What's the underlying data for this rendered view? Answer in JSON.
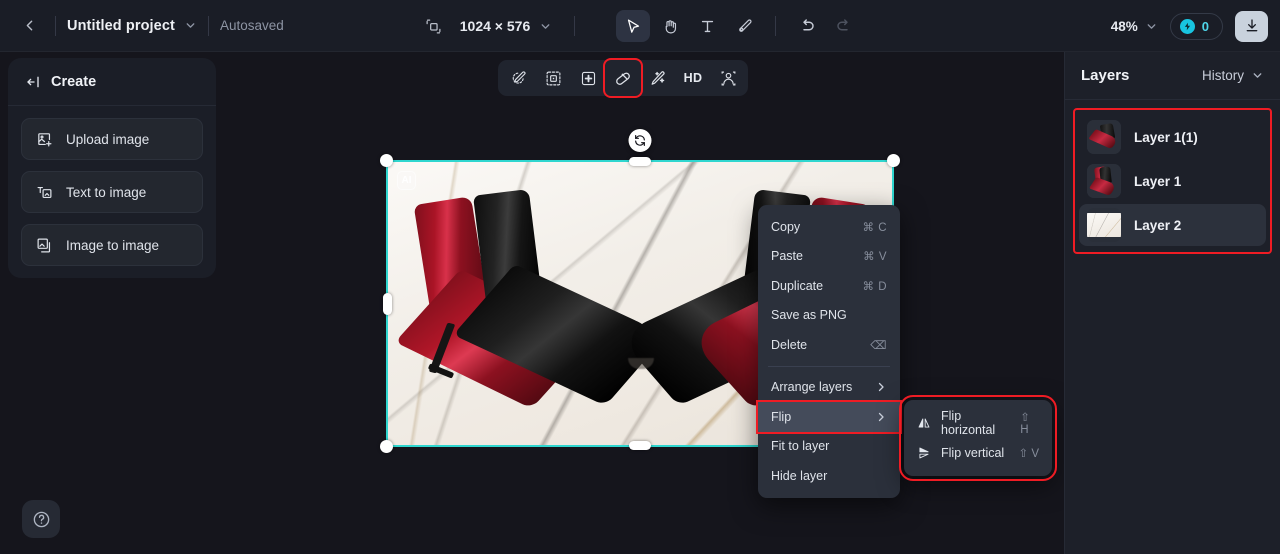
{
  "topbar": {
    "back_icon": "chevron-left-icon",
    "project_name": "Untitled project",
    "project_caret": "chevron-down-icon",
    "autosave_status": "Autosaved",
    "resize_icon": "resize-canvas-icon",
    "canvas_size": "1024 × 576",
    "size_caret": "chevron-down-icon",
    "tools": [
      {
        "name": "select-tool",
        "icon": "cursor-icon",
        "active": true
      },
      {
        "name": "hand-tool",
        "icon": "hand-icon",
        "active": false
      },
      {
        "name": "text-tool",
        "icon": "text-t-icon",
        "active": false
      },
      {
        "name": "brush-tool",
        "icon": "brush-icon",
        "active": false
      },
      {
        "name": "undo-tool",
        "icon": "undo-arrow-icon",
        "active": false
      },
      {
        "name": "redo-tool",
        "icon": "redo-arrow-icon",
        "active": false
      }
    ],
    "zoom_level": "48%",
    "zoom_caret": "chevron-down-icon",
    "credits_icon": "coin-icon",
    "credits_count": "0",
    "download_icon": "download-icon"
  },
  "create_panel": {
    "collapse_icon": "collapse-left-icon",
    "title": "Create",
    "items": [
      {
        "label": "Upload image",
        "icon": "image-upload-icon"
      },
      {
        "label": "Text to image",
        "icon": "text-to-image-icon"
      },
      {
        "label": "Image to image",
        "icon": "image-to-image-icon"
      }
    ],
    "help_icon": "question-mark-icon"
  },
  "canvas_toolbar": {
    "buttons": [
      {
        "name": "magic-erase-button",
        "icon": "magic-eraser-icon",
        "label": "",
        "highlighted": false
      },
      {
        "name": "expand-button",
        "icon": "expand-frame-icon",
        "label": "",
        "highlighted": false
      },
      {
        "name": "remove-background-button",
        "icon": "remove-bg-icon",
        "label": "",
        "highlighted": false
      },
      {
        "name": "eraser-button",
        "icon": "eraser-icon",
        "label": "",
        "highlighted": true
      },
      {
        "name": "enhance-button",
        "icon": "magic-wand-icon",
        "label": "",
        "highlighted": false
      },
      {
        "name": "hd-button",
        "icon": "hd-text-icon",
        "label": "HD",
        "highlighted": false
      },
      {
        "name": "avatar-button",
        "icon": "person-portrait-icon",
        "label": "",
        "highlighted": false
      }
    ]
  },
  "canvas": {
    "ai_badge": "AI",
    "rotate_icon": "rotate-icon",
    "selection_color": "#2fd6cf"
  },
  "context_menu": {
    "items": [
      {
        "label": "Copy",
        "shortcut": "⌘ C",
        "arrow": false,
        "selected": false,
        "highlighted": false
      },
      {
        "label": "Paste",
        "shortcut": "⌘ V",
        "arrow": false,
        "selected": false,
        "highlighted": false
      },
      {
        "label": "Duplicate",
        "shortcut": "⌘ D",
        "arrow": false,
        "selected": false,
        "highlighted": false
      },
      {
        "label": "Save as PNG",
        "shortcut": "",
        "arrow": false,
        "selected": false,
        "highlighted": false
      },
      {
        "label": "Delete",
        "shortcut": "⌫",
        "arrow": false,
        "selected": false,
        "highlighted": false
      },
      {
        "separator": true
      },
      {
        "label": "Arrange layers",
        "shortcut": "",
        "arrow": true,
        "selected": false,
        "highlighted": false
      },
      {
        "label": "Flip",
        "shortcut": "",
        "arrow": true,
        "selected": true,
        "highlighted": true
      },
      {
        "label": "Fit to layer",
        "shortcut": "",
        "arrow": false,
        "selected": false,
        "highlighted": false
      },
      {
        "label": "Hide layer",
        "shortcut": "",
        "arrow": false,
        "selected": false,
        "highlighted": false
      }
    ]
  },
  "flip_submenu": {
    "items": [
      {
        "label": "Flip horizontal",
        "shortcut": "⇧ H",
        "icon": "flip-horizontal-icon"
      },
      {
        "label": "Flip vertical",
        "shortcut": "⇧ V",
        "icon": "flip-vertical-icon"
      }
    ]
  },
  "layers_panel": {
    "title": "Layers",
    "history_label": "History",
    "history_caret": "chevron-down-icon",
    "layers": [
      {
        "name": "Layer 1(1)",
        "thumb": "boots-flipped",
        "active": false
      },
      {
        "name": "Layer 1",
        "thumb": "boots",
        "active": false
      },
      {
        "name": "Layer 2",
        "thumb": "marble",
        "active": true
      }
    ]
  },
  "colors": {
    "accent_selection": "#2fd6cf",
    "highlight_outline": "#ef1c24",
    "credit_cyan": "#4fd6ea",
    "panel_bg": "#1d2029",
    "canvas_bg": "#15151c"
  }
}
